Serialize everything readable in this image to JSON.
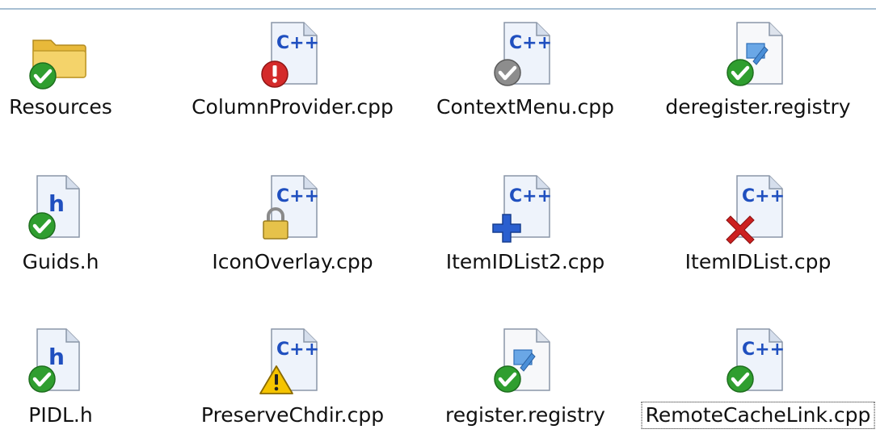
{
  "files": [
    {
      "label": "Resources",
      "icon": "folder-icon",
      "overlay": "check-overlay-icon"
    },
    {
      "label": "ColumnProvider.cpp",
      "icon": "cpp-file-icon",
      "overlay": "error-overlay-icon"
    },
    {
      "label": "ContextMenu.cpp",
      "icon": "cpp-file-icon",
      "overlay": "grey-check-overlay-icon"
    },
    {
      "label": "deregister.registry",
      "icon": "registry-file-icon",
      "overlay": "check-overlay-icon"
    },
    {
      "label": "Guids.h",
      "icon": "h-file-icon",
      "overlay": "check-overlay-icon"
    },
    {
      "label": "IconOverlay.cpp",
      "icon": "cpp-file-icon",
      "overlay": "lock-overlay-icon"
    },
    {
      "label": "ItemIDList2.cpp",
      "icon": "cpp-file-icon",
      "overlay": "add-overlay-icon"
    },
    {
      "label": "ItemIDList.cpp",
      "icon": "cpp-file-icon",
      "overlay": "deleted-overlay-icon"
    },
    {
      "label": "PIDL.h",
      "icon": "h-file-icon",
      "overlay": "check-overlay-icon"
    },
    {
      "label": "PreserveChdir.cpp",
      "icon": "cpp-file-icon",
      "overlay": "warning-overlay-icon"
    },
    {
      "label": "register.registry",
      "icon": "registry-file-icon",
      "overlay": "check-overlay-icon"
    },
    {
      "label": "RemoteCacheLink.cpp",
      "icon": "cpp-file-icon",
      "overlay": "check-overlay-icon"
    }
  ],
  "colors": {
    "check_green": "#2f9e2f",
    "error_red": "#d42a2a",
    "add_blue": "#2a5fcf",
    "delete_red": "#cc2020",
    "lock_gold": "#e6c24a",
    "warning_yellow": "#f5c400",
    "folder_yellow": "#f4d36a",
    "file_border": "#8a96a8",
    "cpp_blue": "#1f4fbf"
  }
}
